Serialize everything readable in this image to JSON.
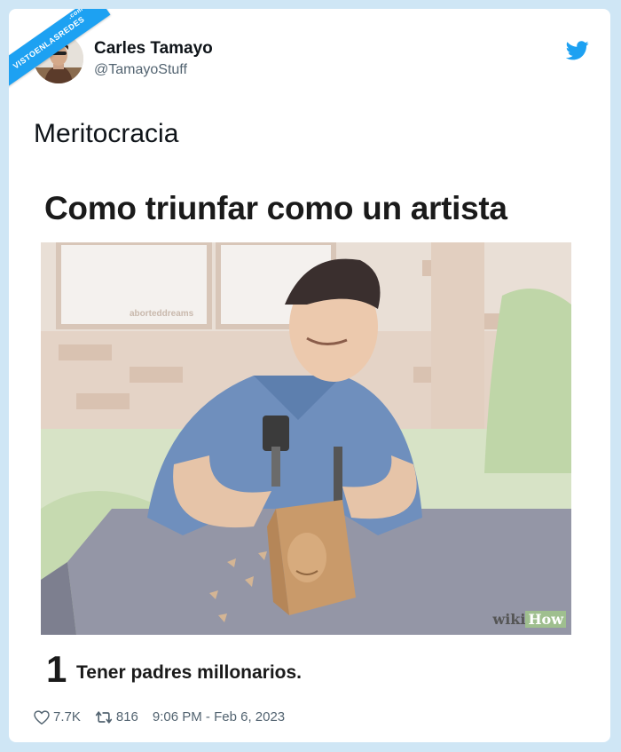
{
  "watermark": {
    "ribbon_text": "VISTOENLASREDES",
    "ribbon_suffix": ".com"
  },
  "tweet": {
    "author_name": "Carles Tamayo",
    "author_handle": "@TamayoStuff",
    "text": "Meritocracia",
    "likes": "7.7K",
    "retweets": "816",
    "timestamp": "9:06 PM - Feb 6, 2023"
  },
  "meme": {
    "title": "Como triunfar como un artista",
    "image_watermark": "aborteddreams",
    "step_number": "1",
    "step_text": "Tener padres millonarios.",
    "brand_wiki": "wiki",
    "brand_how": "How"
  },
  "icons": [
    "twitter-bird-icon",
    "heart-icon",
    "retweet-icon"
  ],
  "colors": {
    "twitter_blue": "#1da1f2",
    "background": "#cfe6f5",
    "muted": "#536471"
  }
}
